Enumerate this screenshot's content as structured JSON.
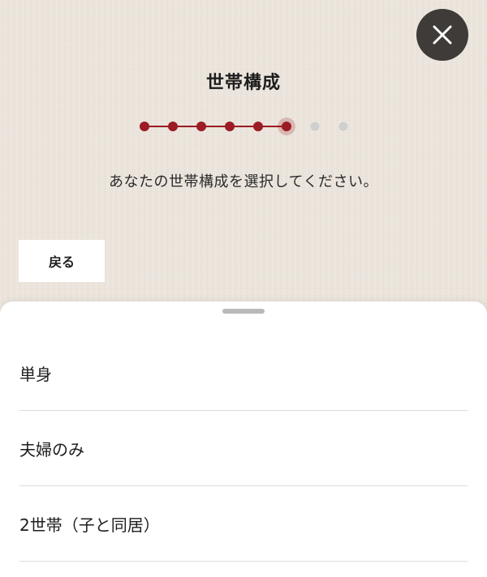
{
  "header": {
    "title": "世帯構成",
    "close_icon": "close-icon",
    "close_bg": "#3f3b38"
  },
  "progress": {
    "total_steps": 8,
    "current_step": 6,
    "completed_color": "#9b1c24",
    "pending_color": "#cfcfcf"
  },
  "instruction": "あなたの世帯構成を選択してください。",
  "back_label": "戻る",
  "sheet": {
    "options": [
      {
        "label": "単身"
      },
      {
        "label": "夫婦のみ"
      },
      {
        "label": "2世帯（子と同居）"
      }
    ]
  }
}
